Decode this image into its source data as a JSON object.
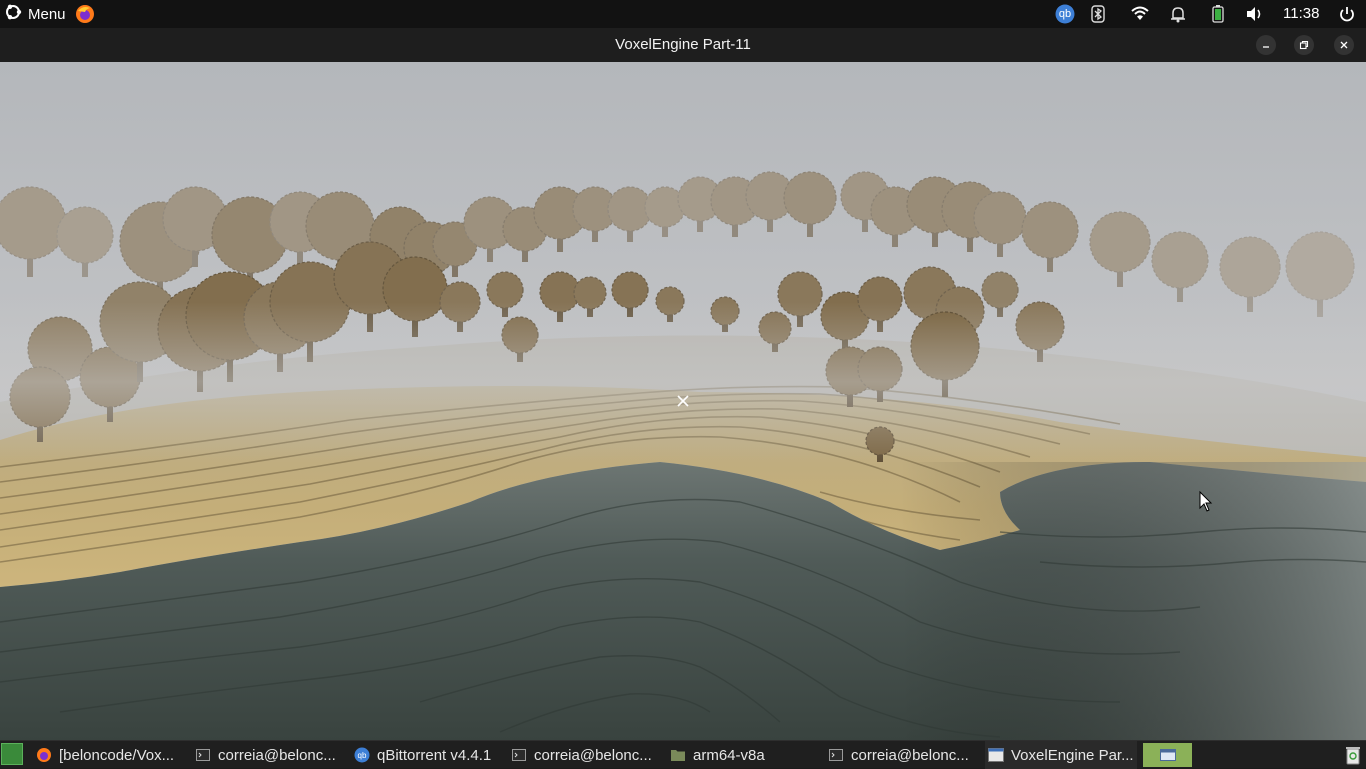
{
  "top_panel": {
    "menu_label": "Menu",
    "clock": "11:38",
    "tray_icons": [
      "qbittorrent-icon",
      "bluetooth-icon",
      "wifi-icon",
      "notifications-icon",
      "battery-icon",
      "volume-icon",
      "power-icon"
    ],
    "qb_label": "qb"
  },
  "window": {
    "title": "VoxelEngine Part-11"
  },
  "taskbar": {
    "items": [
      {
        "label": "[beloncode/Vox...",
        "icon": "firefox-icon"
      },
      {
        "label": "correia@belonc...",
        "icon": "terminal-icon"
      },
      {
        "label": "qBittorrent v4.4.1",
        "icon": "qbittorrent-icon"
      },
      {
        "label": "correia@belonc...",
        "icon": "terminal-icon"
      },
      {
        "label": "arm64-v8a",
        "icon": "folder-icon"
      },
      {
        "label": "correia@belonc...",
        "icon": "terminal-icon"
      },
      {
        "label": "VoxelEngine Par...",
        "icon": "window-icon"
      }
    ]
  },
  "colors": {
    "sky": "#b9bcc0",
    "fog": "#c9cacb",
    "sand": "#c9b27a",
    "water": "#47524f",
    "tree": "#7a6440",
    "panel": "#121212",
    "workspace_accent": "#8bb158"
  }
}
